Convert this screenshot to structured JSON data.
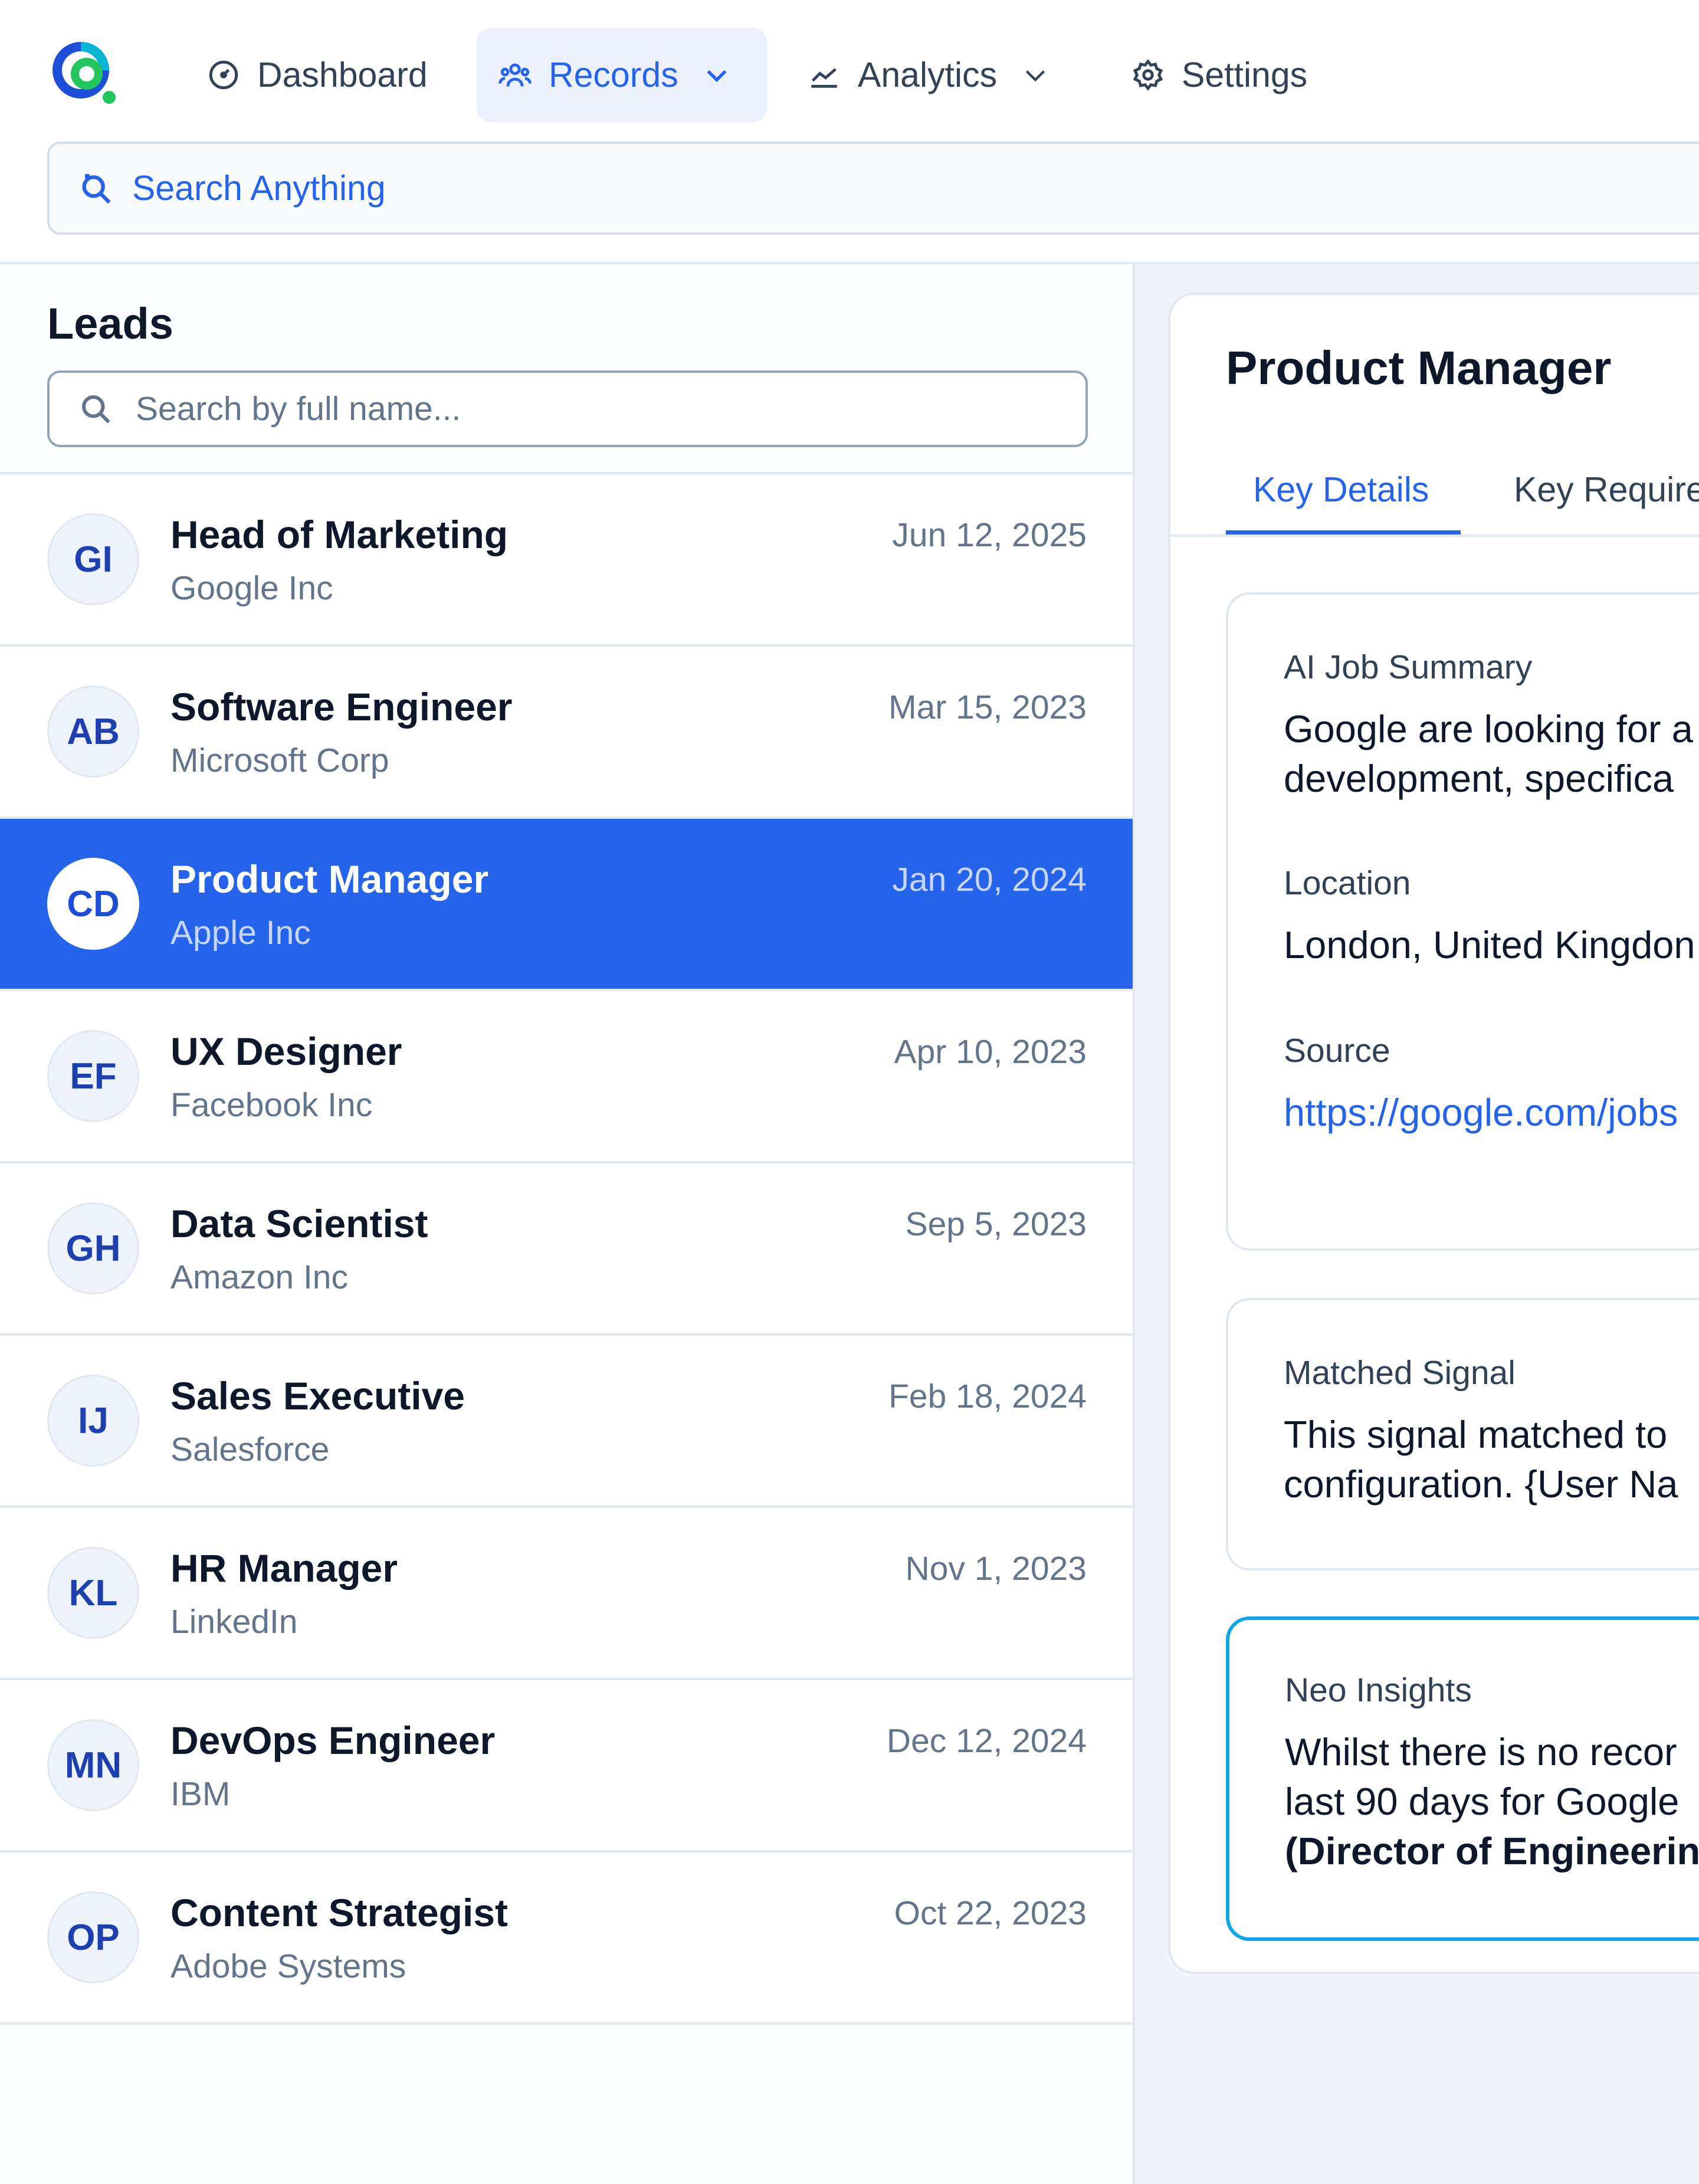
{
  "nav": {
    "items": [
      {
        "label": "Dashboard",
        "icon": "gauge-icon"
      },
      {
        "label": "Records",
        "icon": "users-icon",
        "active": true,
        "has_dropdown": true
      },
      {
        "label": "Analytics",
        "icon": "chart-line-icon",
        "has_dropdown": true
      },
      {
        "label": "Settings",
        "icon": "gear-icon"
      }
    ],
    "global_search_text": "Search Anything"
  },
  "leads": {
    "title": "Leads",
    "search_placeholder": "Search by full name...",
    "items": [
      {
        "initials": "GI",
        "title": "Head of Marketing",
        "company": "Google Inc",
        "date": "Jun 12, 2025"
      },
      {
        "initials": "AB",
        "title": "Software Engineer",
        "company": "Microsoft Corp",
        "date": "Mar 15, 2023"
      },
      {
        "initials": "CD",
        "title": "Product Manager",
        "company": "Apple Inc",
        "date": "Jan 20, 2024",
        "selected": true
      },
      {
        "initials": "EF",
        "title": "UX Designer",
        "company": "Facebook Inc",
        "date": "Apr 10, 2023"
      },
      {
        "initials": "GH",
        "title": "Data Scientist",
        "company": "Amazon Inc",
        "date": "Sep 5, 2023"
      },
      {
        "initials": "IJ",
        "title": "Sales Executive",
        "company": "Salesforce",
        "date": "Feb 18, 2024"
      },
      {
        "initials": "KL",
        "title": "HR Manager",
        "company": "LinkedIn",
        "date": "Nov 1, 2023"
      },
      {
        "initials": "MN",
        "title": "DevOps Engineer",
        "company": "IBM",
        "date": "Dec 12, 2024"
      },
      {
        "initials": "OP",
        "title": "Content Strategist",
        "company": "Adobe Systems",
        "date": "Oct 22, 2023"
      }
    ]
  },
  "detail": {
    "title": "Product Manager",
    "tabs": [
      "Key Details",
      "Key Require"
    ],
    "summary_card": {
      "summary_label": "AI Job Summary",
      "summary_line1": "Google are looking for a",
      "summary_line2": "development, specifica",
      "location_label": "Location",
      "location_value": "London, United Kingdon",
      "source_label": "Source",
      "source_value": "https://google.com/jobs"
    },
    "signal_card": {
      "label": "Matched Signal",
      "line1": "This signal matched to",
      "line2": "configuration. {User Na"
    },
    "insights_card": {
      "label": "Neo Insights",
      "line1": "Whilst there is no recor",
      "line2": "last 90 days for Google",
      "line3": "(Director of Engineerin"
    }
  },
  "colors": {
    "accent": "#2563eb",
    "insights_border": "#0ea5e9",
    "logo_blue": "#2563eb",
    "logo_green": "#22c55e"
  }
}
